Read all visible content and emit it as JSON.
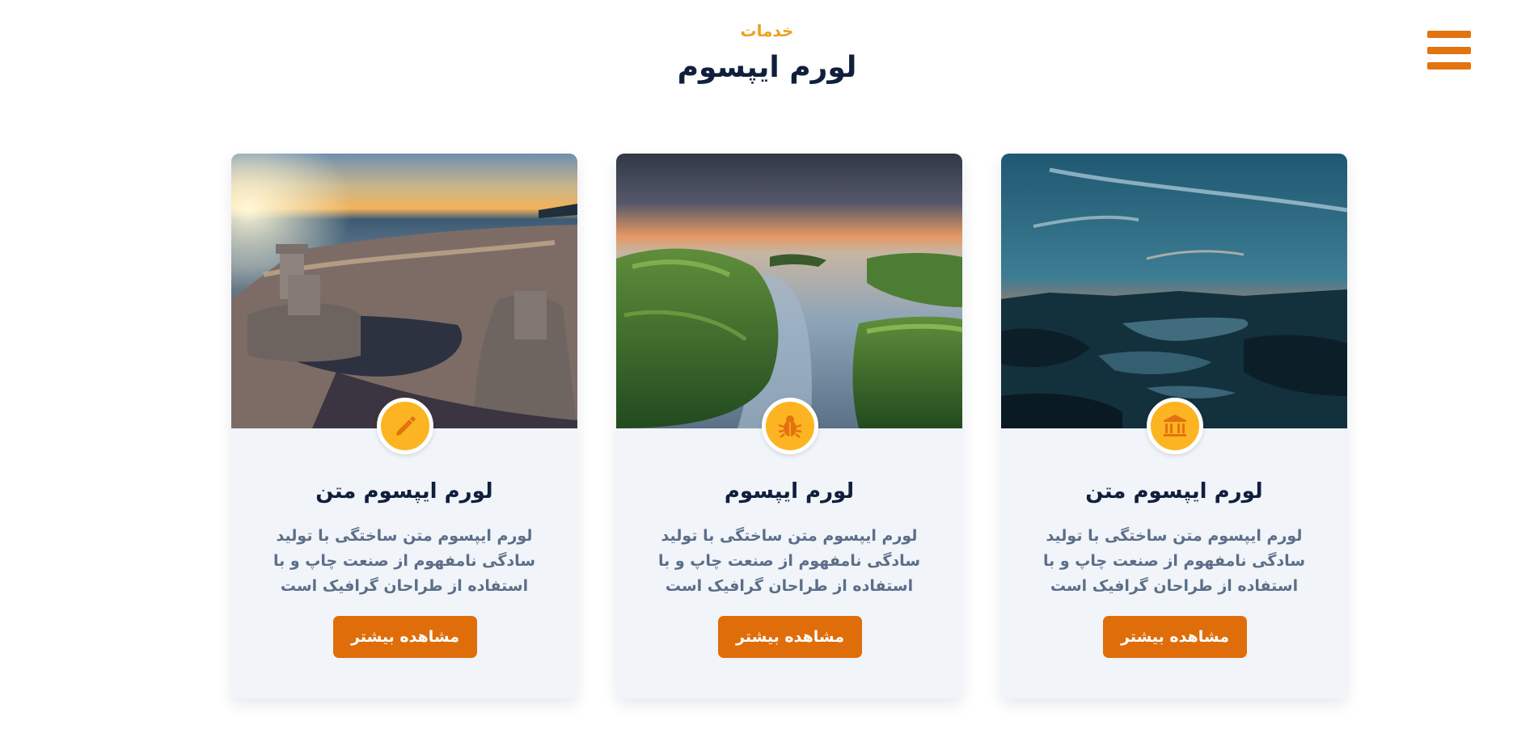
{
  "header": {
    "subtitle": "خدمات",
    "title": "لورم ایپسوم"
  },
  "menu": {
    "icon": "hamburger-menu-icon"
  },
  "colors": {
    "accent": "#e2730f",
    "badge": "#fdb422",
    "heading": "#0f1f3c",
    "body_text": "#5b6e8a",
    "card_bg": "#f1f4f8"
  },
  "cards": [
    {
      "image": "lake-sunset-photo",
      "icon": "bank-icon",
      "title": "لورم ایپسوم متن",
      "text": "لورم ایپسوم متن ساختگی با تولید سادگی نامفهوم از صنعت چاپ و با استفاده از طراحان گرافیک است",
      "button": "مشاهده بیشتر"
    },
    {
      "image": "mossy-coast-photo",
      "icon": "bug-icon",
      "title": "لورم ایپسوم",
      "text": "لورم ایپسوم متن ساختگی با تولید سادگی نامفهوم از صنعت چاپ و با استفاده از طراحان گرافیک است",
      "button": "مشاهده بیشتر"
    },
    {
      "image": "beach-sandcastle-photo",
      "icon": "pencil-icon",
      "title": "لورم ایپسوم متن",
      "text": "لورم ایپسوم متن ساختگی با تولید سادگی نامفهوم از صنعت چاپ و با استفاده از طراحان گرافیک است",
      "button": "مشاهده بیشتر"
    }
  ]
}
